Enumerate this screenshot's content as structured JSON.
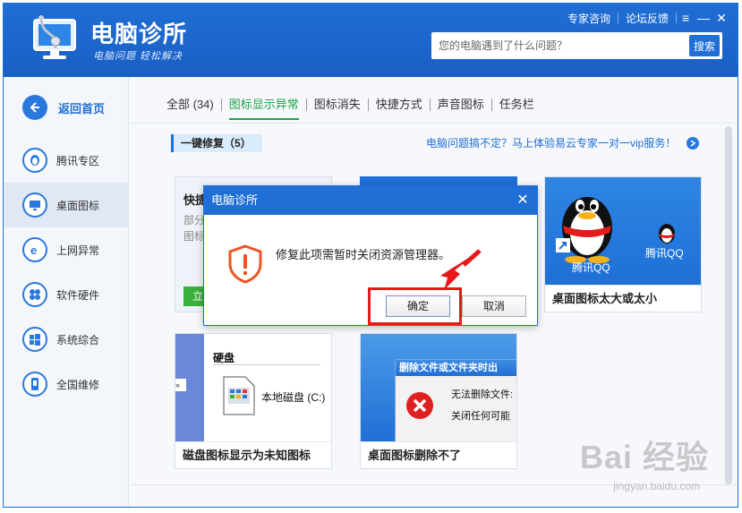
{
  "app": {
    "title": "电脑诊所",
    "slogan": "电脑问题 轻松解决",
    "links": [
      "专家咨询",
      "论坛反馈"
    ]
  },
  "search": {
    "placeholder": "您的电脑遇到了什么问题？",
    "button": "搜索"
  },
  "sidebar": {
    "back_home": "返回首页",
    "items": [
      {
        "label": "腾讯专区",
        "icon": "penguin-icon"
      },
      {
        "label": "桌面图标",
        "icon": "monitor-icon"
      },
      {
        "label": "上网异常",
        "icon": "browser-icon"
      },
      {
        "label": "软件硬件",
        "icon": "gear-icon"
      },
      {
        "label": "系统综合",
        "icon": "windows-icon"
      },
      {
        "label": "全国维修",
        "icon": "phone-icon"
      }
    ],
    "active_index": 1
  },
  "tabs": [
    "全部 (34)",
    "图标显示异常",
    "图标消失",
    "快捷方式",
    "声音图标",
    "任务栏"
  ],
  "active_tab": 1,
  "section": {
    "tag": "一键修复（5）",
    "promo": "电脑问题搞不定？马上体验易云专家一对一vip服务！"
  },
  "cards": {
    "card1_title_fragment": "快捷",
    "card1_desc_fragment": [
      "部分",
      "图标"
    ],
    "card1_button_fragment": "立",
    "qq_icon_label_1": "腾讯QQ",
    "qq_icon_label_2": "腾讯QQ",
    "qq_caption": "桌面图标太大或太小",
    "disk_header": "硬盘",
    "disk_label": "本地磁盘 (C:)",
    "disk_caption": "磁盘图标显示为未知图标",
    "delete_title": "删除文件或文件夹时出",
    "delete_line1": "无法删除文件:",
    "delete_line2": "关闭任何可能",
    "delete_caption": "桌面图标删除不了"
  },
  "dialog": {
    "title": "电脑诊所",
    "message": "修复此项需暂时关闭资源管理器。",
    "ok": "确定",
    "cancel": "取消"
  },
  "watermark": {
    "main": "Bai 经验",
    "sub": "jingyan.baidu.com"
  },
  "colors": {
    "brand_blue": "#1f6fd6",
    "active_tab_green": "#1fa34a",
    "highlight_red": "#e81818",
    "warning_orange": "#f0531f"
  }
}
